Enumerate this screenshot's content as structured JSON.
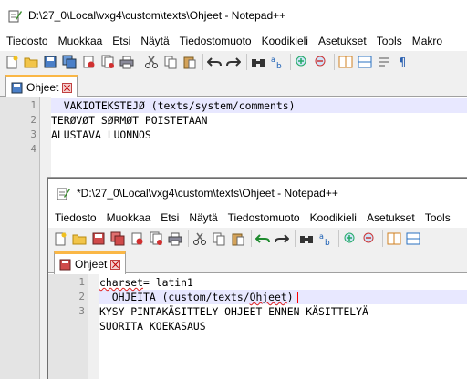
{
  "window1": {
    "title": "D:\\27_0\\Local\\vxg4\\custom\\texts\\Ohjeet - Notepad++",
    "menu": [
      "Tiedosto",
      "Muokkaa",
      "Etsi",
      "Näytä",
      "Tiedostomuoto",
      "Koodikieli",
      "Asetukset",
      "Tools",
      "Makro"
    ],
    "tab_label": "Ohjeet",
    "line_numbers": [
      "1",
      "2",
      "3",
      "4"
    ],
    "lines": [
      "  VAKIOTEKSTEJØ (texts/system/comments)",
      "TERØVØT SØRMØT POISTETAAN",
      "ALUSTAVA LUONNOS",
      ""
    ]
  },
  "window2": {
    "title": "*D:\\27_0\\Local\\vxg4\\custom\\texts\\Ohjeet - Notepad++",
    "menu": [
      "Tiedosto",
      "Muokkaa",
      "Etsi",
      "Näytä",
      "Tiedostomuoto",
      "Koodikieli",
      "Asetukset",
      "Tools"
    ],
    "tab_label": "Ohjeet",
    "line_numbers": [
      "1",
      "2",
      "3"
    ],
    "line1_prefix": "charset",
    "line1_suffix": "= latin1",
    "line2_prefix": "  OHJEITA (custom/texts/",
    "line2_word": "Ohjeet",
    "line2_suffix": ")",
    "lines_extra": [
      "KYSY PINTAKÄSITTELY OHJEET ENNEN KÄSITTELYÄ",
      "SUORITA KOEKASAUS"
    ]
  }
}
